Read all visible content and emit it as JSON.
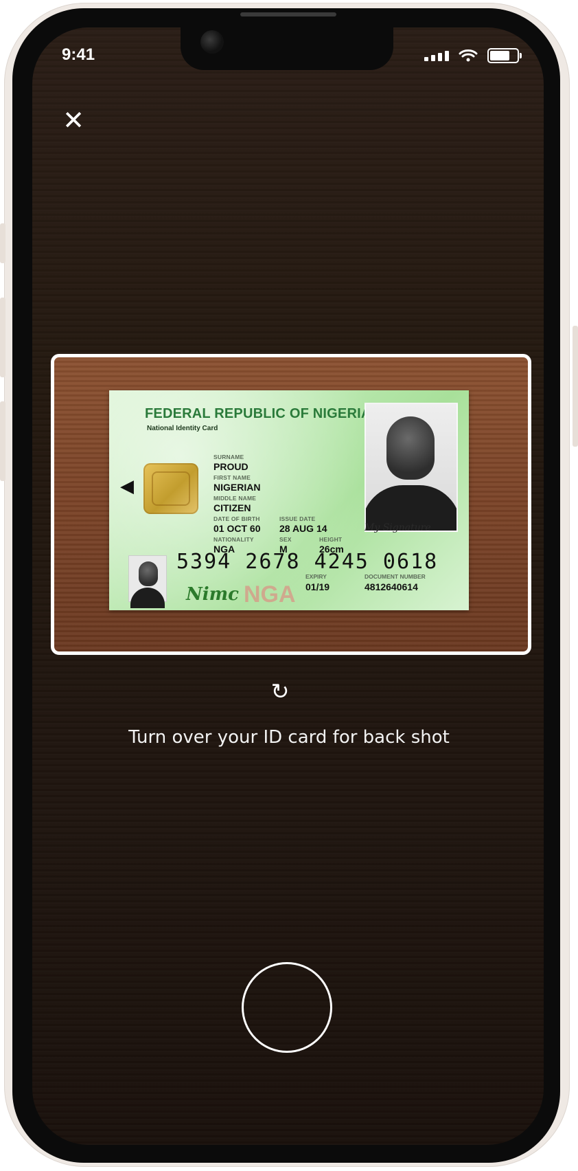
{
  "status_bar": {
    "time": "9:41",
    "icons": [
      "cellular-signal-icon",
      "wifi-icon",
      "battery-icon"
    ]
  },
  "close_icon": "close-icon",
  "id_card": {
    "title": "FEDERAL REPUBLIC OF NIGERIA",
    "subtitle": "National Identity Card",
    "fields": {
      "surname_label": "SURNAME",
      "surname": "PROUD",
      "first_name_label": "FIRST NAME",
      "first_name": "NIGERIAN",
      "middle_name_label": "MIDDLE NAME",
      "middle_name": "CITIZEN",
      "dob_label": "DATE OF BIRTH",
      "dob": "01 OCT 60",
      "issue_label": "ISSUE DATE",
      "issue_date": "28 AUG 14",
      "nationality_label": "NATIONALITY",
      "nationality": "NGA",
      "sex_label": "SEX",
      "sex": "M",
      "height_label": "HEIGHT",
      "height": "26cm"
    },
    "card_number": "5394 2678 4245 0618",
    "issuer_logo": "Nimc",
    "country_watermark": "NGA",
    "signature": "My Signature",
    "expiry_label": "EXPIRY",
    "expiry": "01/19",
    "document_number_label": "DOCUMENT NUMBER",
    "document_number": "4812640614"
  },
  "rotate_icon": "rotate-icon",
  "instruction": "Turn over your ID card for back shot",
  "shutter": "shutter-button"
}
